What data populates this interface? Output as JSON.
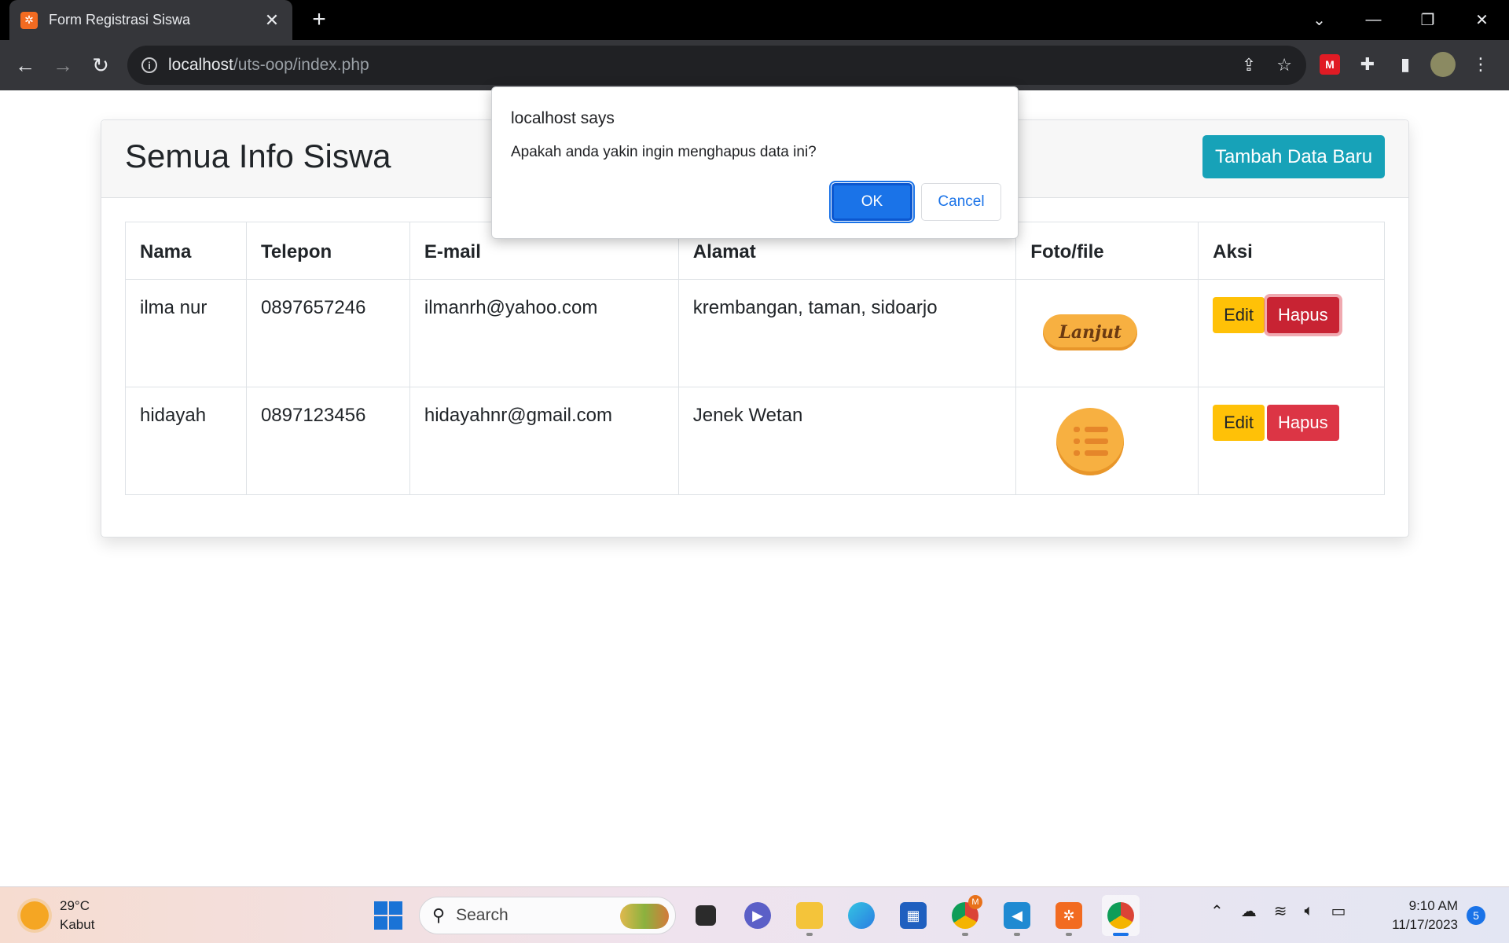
{
  "browser": {
    "tab_title": "Form Registrasi Siswa",
    "tab_favicon": "XAMPP",
    "new_tab": "+",
    "url_host": "localhost",
    "url_path": "/uts-oop/index.php",
    "window_controls": [
      "⌄",
      "—",
      "❐",
      "✕"
    ]
  },
  "page": {
    "title": "Semua Info Siswa",
    "add_button": "Tambah Data Baru",
    "table": {
      "headers": [
        "Nama",
        "Telepon",
        "E-mail",
        "Alamat",
        "Foto/file",
        "Aksi"
      ],
      "rows": [
        {
          "nama": "ilma nur",
          "telepon": "0897657246",
          "email": "ilmanrh@yahoo.com",
          "alamat": "krembangan, taman, sidoarjo",
          "foto_text": "Lanjut",
          "foto_icon": "lanjut-button-image"
        },
        {
          "nama": "hidayah",
          "telepon": "0897123456",
          "email": "hidayahnr@gmail.com",
          "alamat": "Jenek Wetan",
          "foto_icon": "list-icon-image"
        }
      ],
      "edit_label": "Edit",
      "delete_label": "Hapus"
    }
  },
  "dialog": {
    "title": "localhost says",
    "message": "Apakah anda yakin ingin menghapus data ini?",
    "ok": "OK",
    "cancel": "Cancel"
  },
  "taskbar": {
    "weather_temp": "29°C",
    "weather_desc": "Kabut",
    "search_placeholder": "Search",
    "time": "9:10 AM",
    "date": "11/17/2023",
    "notifications": "5",
    "chrome_badge": "M"
  },
  "colors": {
    "info": "#17a2b8",
    "warning": "#ffc107",
    "danger": "#dc3545",
    "dialog_primary": "#1a73e8"
  }
}
